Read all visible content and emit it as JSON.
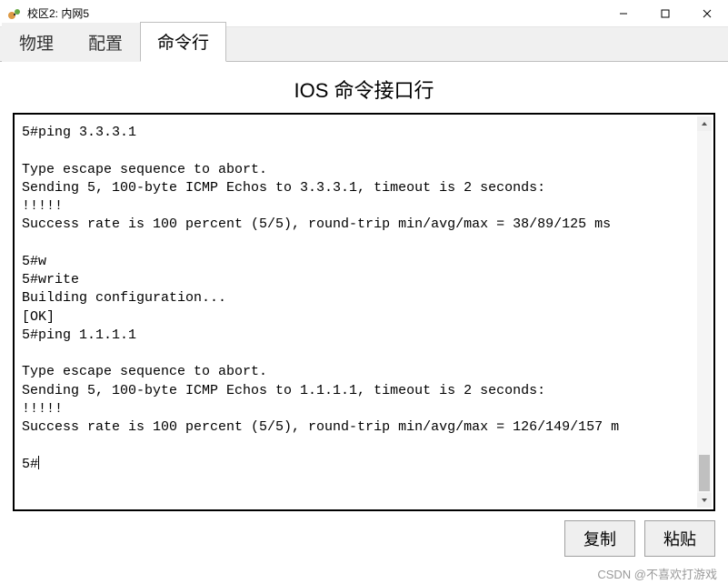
{
  "window": {
    "title": "校区2: 内网5"
  },
  "tabs": {
    "t0": "物理",
    "t1": "配置",
    "t2": "命令行"
  },
  "heading": "IOS 命令接口行",
  "terminal": {
    "text": "5#ping 3.3.3.1\n\nType escape sequence to abort.\nSending 5, 100-byte ICMP Echos to 3.3.3.1, timeout is 2 seconds:\n!!!!!\nSuccess rate is 100 percent (5/5), round-trip min/avg/max = 38/89/125 ms\n\n5#w\n5#write\nBuilding configuration...\n[OK]\n5#ping 1.1.1.1\n\nType escape sequence to abort.\nSending 5, 100-byte ICMP Echos to 1.1.1.1, timeout is 2 seconds:\n!!!!!\nSuccess rate is 100 percent (5/5), round-trip min/avg/max = 126/149/157 m\n\n5#",
    "prompt_cursor": "|"
  },
  "buttons": {
    "copy": "复制",
    "paste": "粘贴"
  },
  "watermark": "CSDN @不喜欢打游戏"
}
